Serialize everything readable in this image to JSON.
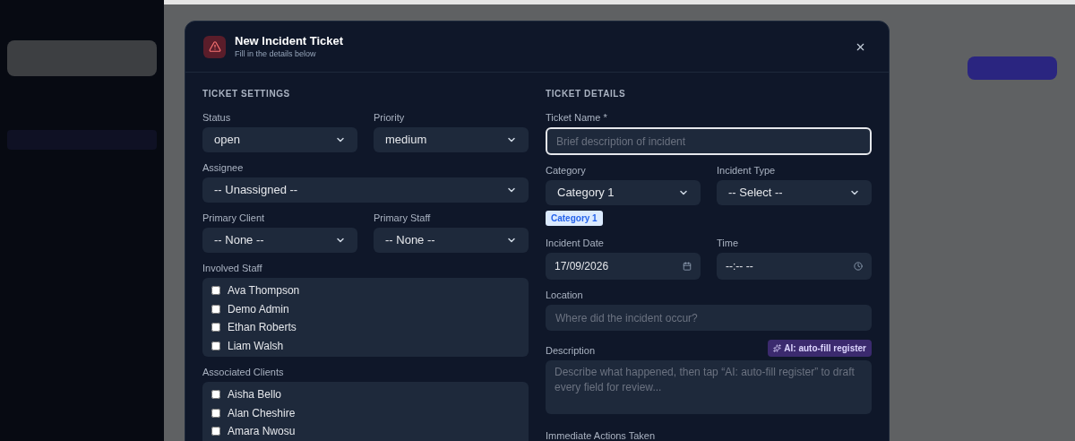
{
  "dialog": {
    "title": "New Incident Ticket",
    "subtitle": "Fill in the details below"
  },
  "left_column": {
    "title": "TICKET SETTINGS",
    "rows": [
      [
        {
          "kind": "select",
          "label": "Status",
          "value": "open"
        },
        {
          "kind": "select",
          "label": "Priority",
          "value": "medium"
        }
      ],
      [
        {
          "kind": "select",
          "label": "Assignee",
          "value": "-- Unassigned --"
        }
      ],
      [
        {
          "kind": "select",
          "label": "Primary Client",
          "value": "-- None --"
        },
        {
          "kind": "select",
          "label": "Primary Staff",
          "value": "-- None --"
        }
      ],
      [
        {
          "kind": "checklist",
          "label": "Involved Staff",
          "items": [
            {
              "label": "Ava Thompson",
              "checked": false
            },
            {
              "label": "Demo Admin",
              "checked": false
            },
            {
              "label": "Ethan Roberts",
              "checked": false
            },
            {
              "label": "Liam Walsh",
              "checked": false
            }
          ]
        }
      ],
      [
        {
          "kind": "checklist",
          "label": "Associated Clients",
          "items": [
            {
              "label": "Aisha Bello",
              "checked": false
            },
            {
              "label": "Alan Cheshire",
              "checked": false
            },
            {
              "label": "Amara Nwosu",
              "checked": false
            }
          ]
        }
      ]
    ]
  },
  "right_column": {
    "title": "TICKET DETAILS",
    "rows": [
      [
        {
          "kind": "text",
          "label": "Ticket Name *",
          "placeholder": "Brief description of incident",
          "focused": true
        }
      ],
      [
        {
          "kind": "select",
          "label": "Category",
          "value": "Category 1",
          "tag": "Category 1"
        },
        {
          "kind": "select",
          "label": "Incident Type",
          "value": "-- Select --"
        }
      ],
      [
        {
          "kind": "date",
          "label": "Incident Date",
          "value": "17/09/2026"
        },
        {
          "kind": "time",
          "label": "Time",
          "value": "--:-- --"
        }
      ],
      [
        {
          "kind": "text",
          "label": "Location",
          "placeholder": "Where did the incident occur?",
          "focused": false
        }
      ],
      [
        {
          "kind": "textarea",
          "label": "Description",
          "placeholder": "Describe what happened, then tap “AI: auto-fill register” to draft every field for review...",
          "action": "AI: auto-fill register"
        }
      ],
      [
        {
          "kind": "textarea",
          "label": "Immediate Actions Taken"
        }
      ]
    ]
  }
}
